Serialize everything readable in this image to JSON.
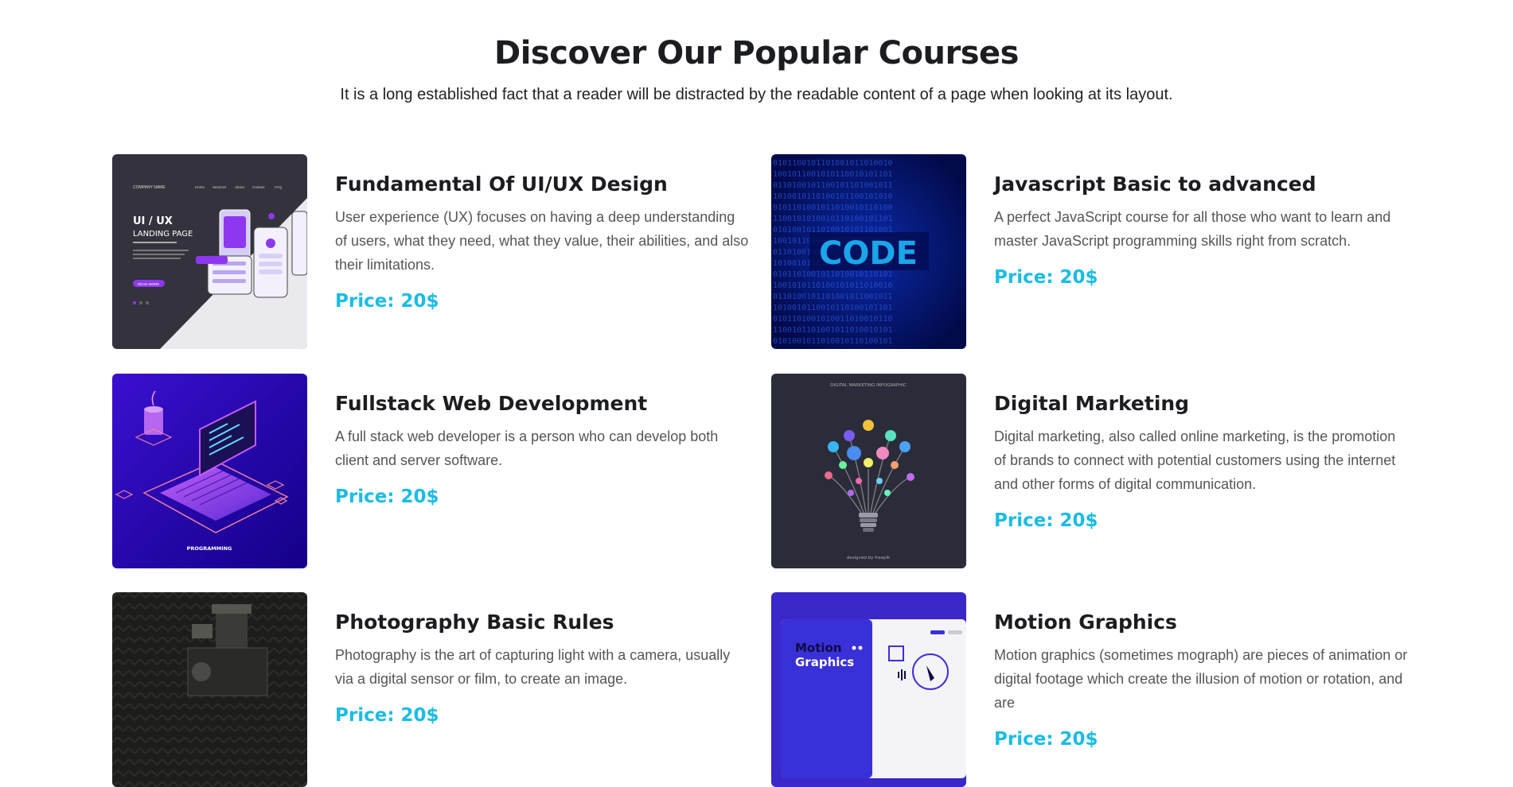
{
  "section": {
    "title": "Discover Our Popular Courses",
    "subtitle": "It is a long established fact that a reader will be distracted by the readable content of a page when looking at its layout."
  },
  "courses": [
    {
      "title": "Fundamental Of UI/UX Design",
      "description": "User experience (UX) focuses on having a deep understanding of users, what they need, what they value, their abilities, and also their limitations.",
      "price": "Price: 20$",
      "thumb": {
        "company": "COMPANY NAME",
        "nav": [
          "Home",
          "Services",
          "About",
          "Contact",
          "FAQ"
        ],
        "heading1": "UI / UX",
        "heading2": "LANDING PAGE",
        "button": "READ MORE"
      }
    },
    {
      "title": "Javascript Basic to advanced",
      "description": "A perfect JavaScript course for all those who want to learn and master JavaScript programming skills right from scratch.",
      "price": "Price: 20$",
      "thumb": {
        "word": "CODE"
      }
    },
    {
      "title": "Fullstack Web Development",
      "description": "A full stack web developer is a person who can develop both client and server software.",
      "price": "Price: 20$",
      "thumb": {
        "caption": "PROGRAMMING"
      }
    },
    {
      "title": "Digital Marketing",
      "description": "Digital marketing, also called online marketing, is the promotion of brands to connect with potential customers using the internet and other forms of digital communication.",
      "price": "Price: 20$",
      "thumb": {
        "caption": "DIGITAL MARKETING INFOGRAPHIC",
        "credit": "designed by freepik"
      }
    },
    {
      "title": "Photography Basic Rules",
      "description": "Photography is the art of capturing light with a camera, usually via a digital sensor or film, to create an image.",
      "price": "Price: 20$"
    },
    {
      "title": "Motion Graphics",
      "description": "Motion graphics (sometimes mograph) are pieces of animation or digital footage which create the illusion of motion or rotation, and are",
      "price": "Price: 20$",
      "thumb": {
        "line1": "Motion",
        "line2": "Graphics"
      }
    }
  ],
  "colors": {
    "accent": "#1bbce3",
    "heading": "#1c1d21",
    "body": "#555555"
  }
}
